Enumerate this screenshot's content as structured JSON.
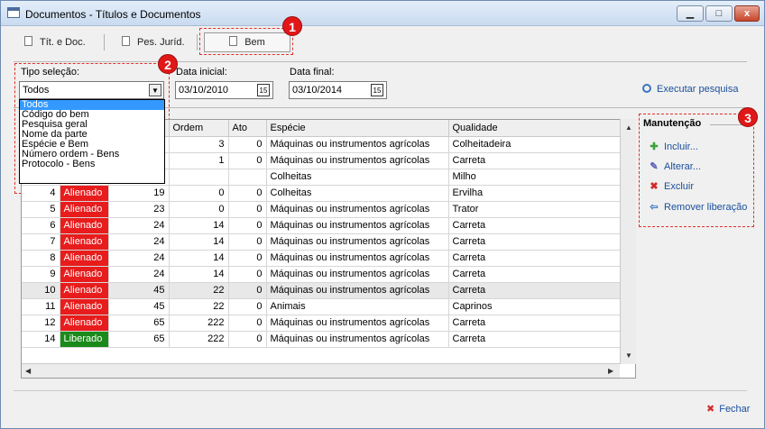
{
  "window": {
    "title": "Documentos - Títulos e Documentos",
    "minimize_glyph": "▁",
    "maximize_glyph": "□",
    "close_glyph": "x"
  },
  "tabs": [
    {
      "label": "Tít. e Doc."
    },
    {
      "label": "Pes. Juríd."
    },
    {
      "label": "Bem"
    }
  ],
  "badges": {
    "b1": "1",
    "b2": "2",
    "b3": "3"
  },
  "filters": {
    "tipo_label": "Tipo seleção:",
    "tipo_value": "Todos",
    "tipo_options": [
      "Todos",
      "Código do bem",
      "Pesquisa geral",
      "Nome da parte",
      "Espécie e Bem",
      "Número ordem - Bens",
      "Protocolo - Bens"
    ],
    "data_inicial_label": "Data inicial:",
    "data_inicial": "03/10/2010",
    "data_final_label": "Data final:",
    "data_final": "03/10/2014",
    "calendar_glyph": "15",
    "search_label": "Executar pesquisa"
  },
  "grid": {
    "columns": [
      "",
      "",
      "",
      "Ordem",
      "Ato",
      "Espécie",
      "Qualidade"
    ],
    "rows": [
      {
        "id": "",
        "status": "",
        "num": "",
        "ordem": "3",
        "ato": "0",
        "especie": "Máquinas ou instrumentos agrícolas",
        "qualidade": "Colheitadeira",
        "grey": false
      },
      {
        "id": "",
        "status": "",
        "num": "",
        "ordem": "1",
        "ato": "0",
        "especie": "Máquinas ou instrumentos agrícolas",
        "qualidade": "Carreta",
        "grey": false
      },
      {
        "id": "",
        "status": "",
        "num": "",
        "ordem": "",
        "ato": "",
        "especie": "Colheitas",
        "qualidade": "Milho",
        "grey": false
      },
      {
        "id": "4",
        "status": "Alienado",
        "num": "19",
        "ordem": "0",
        "ato": "0",
        "especie": "Colheitas",
        "qualidade": "Ervilha",
        "grey": false
      },
      {
        "id": "5",
        "status": "Alienado",
        "num": "23",
        "ordem": "0",
        "ato": "0",
        "especie": "Máquinas ou instrumentos agrícolas",
        "qualidade": "Trator",
        "grey": false
      },
      {
        "id": "6",
        "status": "Alienado",
        "num": "24",
        "ordem": "14",
        "ato": "0",
        "especie": "Máquinas ou instrumentos agrícolas",
        "qualidade": "Carreta",
        "grey": false
      },
      {
        "id": "7",
        "status": "Alienado",
        "num": "24",
        "ordem": "14",
        "ato": "0",
        "especie": "Máquinas ou instrumentos agrícolas",
        "qualidade": "Carreta",
        "grey": false
      },
      {
        "id": "8",
        "status": "Alienado",
        "num": "24",
        "ordem": "14",
        "ato": "0",
        "especie": "Máquinas ou instrumentos agrícolas",
        "qualidade": "Carreta",
        "grey": false
      },
      {
        "id": "9",
        "status": "Alienado",
        "num": "24",
        "ordem": "14",
        "ato": "0",
        "especie": "Máquinas ou instrumentos agrícolas",
        "qualidade": "Carreta",
        "grey": false
      },
      {
        "id": "10",
        "status": "Alienado",
        "num": "45",
        "ordem": "22",
        "ato": "0",
        "especie": "Máquinas ou instrumentos agrícolas",
        "qualidade": "Carreta",
        "grey": true
      },
      {
        "id": "11",
        "status": "Alienado",
        "num": "45",
        "ordem": "22",
        "ato": "0",
        "especie": "Animais",
        "qualidade": "Caprinos",
        "grey": false
      },
      {
        "id": "12",
        "status": "Alienado",
        "num": "65",
        "ordem": "222",
        "ato": "0",
        "especie": "Máquinas ou instrumentos agrícolas",
        "qualidade": "Carreta",
        "grey": false
      },
      {
        "id": "14",
        "status": "Liberado",
        "num": "65",
        "ordem": "222",
        "ato": "0",
        "especie": "Máquinas ou instrumentos agrícolas",
        "qualidade": "Carreta",
        "grey": false
      }
    ],
    "status_colors": {
      "Alienado": "#e81c1c",
      "Liberado": "#1a8a1a"
    }
  },
  "manutencao": {
    "title": "Manutenção",
    "items": [
      {
        "label": "Incluir...",
        "icon": "plus-icon",
        "glyph": "✚"
      },
      {
        "label": "Alterar...",
        "icon": "pencil-icon",
        "glyph": "✎"
      },
      {
        "label": "Excluir",
        "icon": "x-icon",
        "glyph": "✖"
      },
      {
        "label": "Remover liberação",
        "icon": "arrow-left-icon",
        "glyph": "⇦"
      }
    ]
  },
  "footer": {
    "close_label": "Fechar",
    "close_glyph": "✖"
  }
}
